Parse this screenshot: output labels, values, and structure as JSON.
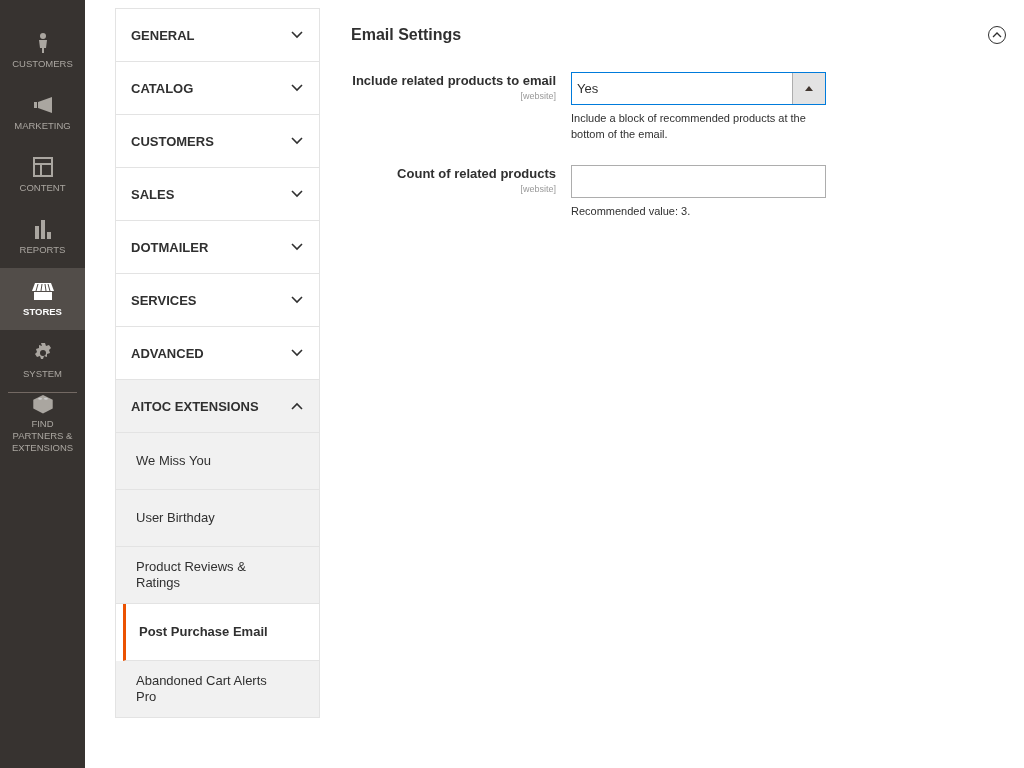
{
  "nav": [
    {
      "label": "CUSTOMERS",
      "selected": false
    },
    {
      "label": "MARKETING",
      "selected": false
    },
    {
      "label": "CONTENT",
      "selected": false
    },
    {
      "label": "REPORTS",
      "selected": false
    },
    {
      "label": "STORES",
      "selected": true
    },
    {
      "label": "SYSTEM",
      "selected": false
    },
    {
      "label": "FIND PARTNERS & EXTENSIONS",
      "selected": false
    }
  ],
  "config_tabs": [
    {
      "label": "GENERAL",
      "expanded": false
    },
    {
      "label": "CATALOG",
      "expanded": false
    },
    {
      "label": "CUSTOMERS",
      "expanded": false
    },
    {
      "label": "SALES",
      "expanded": false
    },
    {
      "label": "DOTMAILER",
      "expanded": false
    },
    {
      "label": "SERVICES",
      "expanded": false
    },
    {
      "label": "ADVANCED",
      "expanded": false
    },
    {
      "label": "AITOC EXTENSIONS",
      "expanded": true,
      "children": [
        {
          "label": "We Miss You",
          "selected": false
        },
        {
          "label": "User Birthday",
          "selected": false
        },
        {
          "label": "Product Reviews & Ratings",
          "selected": false
        },
        {
          "label": "Post Purchase Email",
          "selected": true
        },
        {
          "label": "Abandoned Cart Alerts Pro",
          "selected": false
        }
      ]
    }
  ],
  "section": {
    "title": "Email Settings",
    "expanded": true,
    "fields": [
      {
        "kind": "select",
        "label": "Include related products to email",
        "scope": "[website]",
        "value": "Yes",
        "note": "Include a block of recommended products at the bottom of the email."
      },
      {
        "kind": "text",
        "label": "Count of related products",
        "scope": "[website]",
        "note": "Recommended value: 3."
      }
    ]
  }
}
